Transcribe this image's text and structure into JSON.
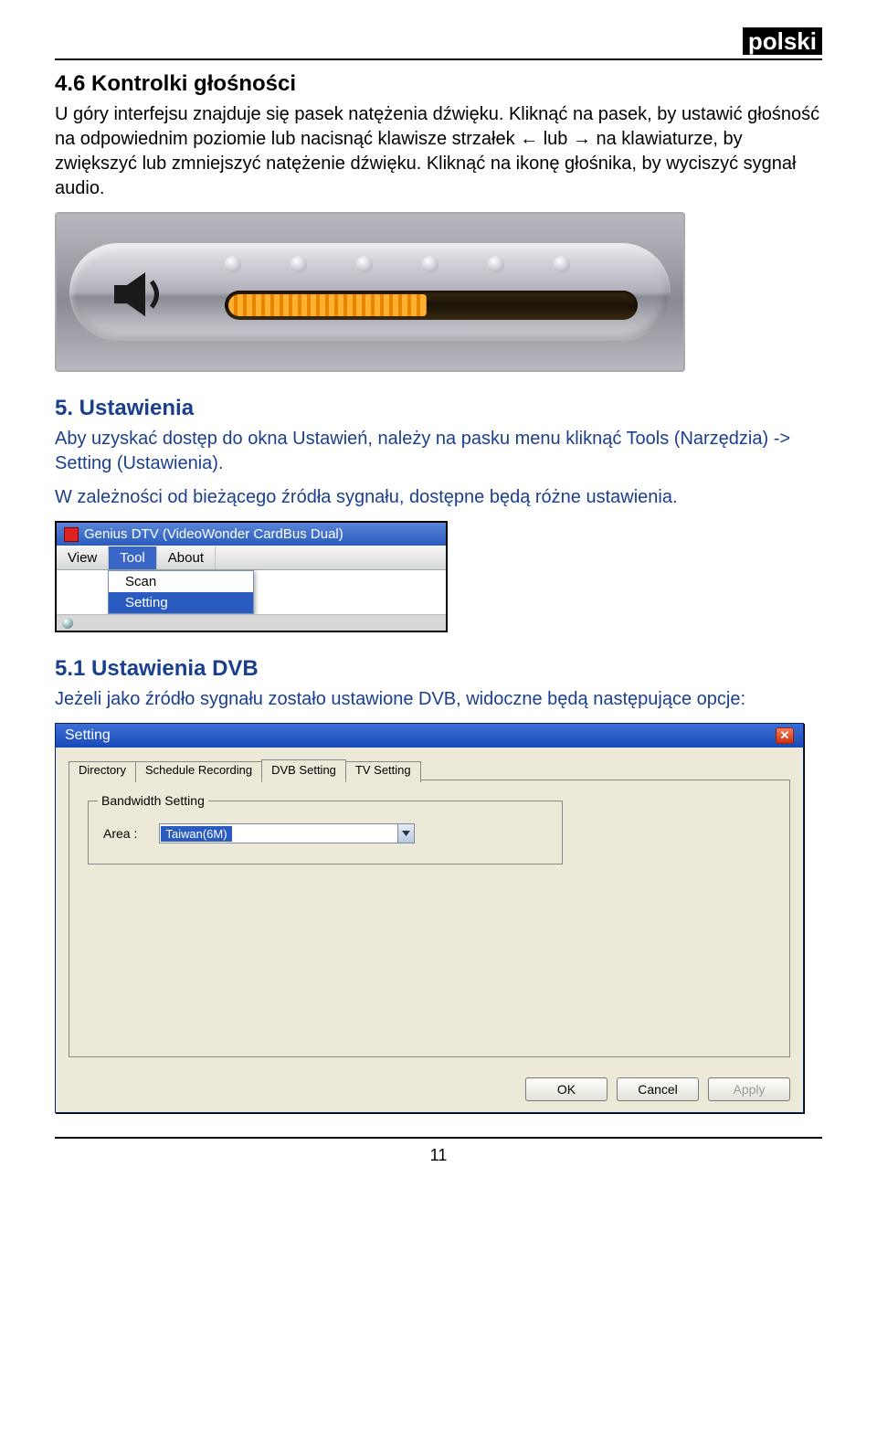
{
  "lang_badge": "polski",
  "section_4_6": {
    "heading": "4.6 Kontrolki głośności",
    "p1": "U góry interfejsu znajduje się pasek natężenia dźwięku. Kliknąć na pasek, by ustawić głośność na odpowiednim poziomie lub nacisnąć klawisze strzałek ← lub → na klawiaturze, by zwiększyć lub zmniejszyć natężenie dźwięku. Kliknąć na ikonę głośnika, by wyciszyć sygnał audio."
  },
  "section_5": {
    "heading": "5. Ustawienia",
    "p1": "Aby uzyskać dostęp do okna Ustawień, należy na pasku menu kliknąć Tools (Narzędzia) -> Setting (Ustawienia).",
    "p2": "W zależności od bieżącego źródła sygnału, dostępne będą różne ustawienia."
  },
  "menu": {
    "title": "Genius DTV (VideoWonder CardBus Dual)",
    "items": [
      "View",
      "Tool",
      "About"
    ],
    "active_item": "Tool",
    "dropdown": [
      "Scan",
      "Setting"
    ],
    "selected": "Setting"
  },
  "section_5_1": {
    "heading": "5.1 Ustawienia DVB",
    "p1": "Jeżeli jako źródło sygnału zostało ustawione DVB, widoczne będą następujące opcje:"
  },
  "dialog": {
    "title": "Setting",
    "tabs": [
      "Directory",
      "Schedule Recording",
      "DVB Setting",
      "TV Setting"
    ],
    "active_tab": "DVB Setting",
    "group_legend": "Bandwidth Setting",
    "area_label": "Area :",
    "area_value": "Taiwan(6M)",
    "buttons": {
      "ok": "OK",
      "cancel": "Cancel",
      "apply": "Apply"
    }
  },
  "page_number": "11"
}
